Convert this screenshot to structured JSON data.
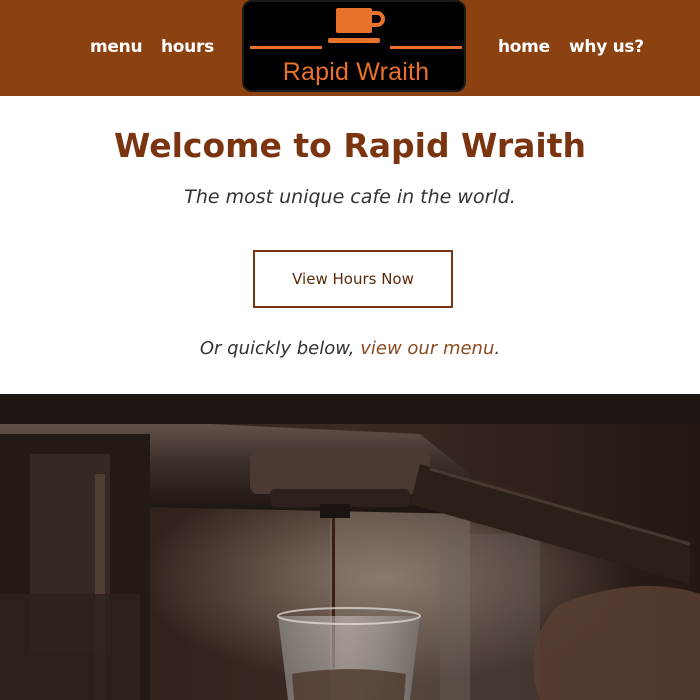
{
  "nav": {
    "left": [
      "menu",
      "hours"
    ],
    "right": [
      "home",
      "why us?"
    ]
  },
  "logo": {
    "text": "Rapid Wraith",
    "icon": "coffee-cup-icon"
  },
  "hero": {
    "title": "Welcome to Rapid Wraith",
    "tagline": "The most unique cafe in the world.",
    "cta_label": "View Hours Now",
    "sub_prefix": "Or quickly below, ",
    "sub_link": "view our menu",
    "sub_suffix": "."
  },
  "colors": {
    "header_bg": "#8b4210",
    "accent": "#e8722a",
    "title": "#7a3510",
    "link": "#8b4a20"
  },
  "photo": {
    "subject": "espresso-machine-photo"
  }
}
